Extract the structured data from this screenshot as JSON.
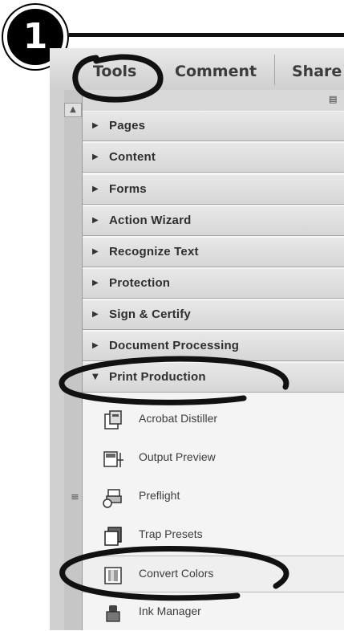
{
  "step": {
    "number": "1"
  },
  "toolbar": {
    "tabs": [
      {
        "label": "Tools"
      },
      {
        "label": "Comment"
      },
      {
        "label": "Share"
      }
    ]
  },
  "panel": {
    "sections": [
      {
        "label": "Pages",
        "state": "collapsed"
      },
      {
        "label": "Content",
        "state": "collapsed"
      },
      {
        "label": "Forms",
        "state": "collapsed"
      },
      {
        "label": "Action Wizard",
        "state": "collapsed"
      },
      {
        "label": "Recognize Text",
        "state": "collapsed"
      },
      {
        "label": "Protection",
        "state": "collapsed"
      },
      {
        "label": "Sign & Certify",
        "state": "collapsed"
      },
      {
        "label": "Document Processing",
        "state": "collapsed"
      },
      {
        "label": "Print Production",
        "state": "expanded"
      }
    ],
    "print_production_items": [
      {
        "label": "Acrobat Distiller",
        "icon": "distiller-icon"
      },
      {
        "label": "Output Preview",
        "icon": "output-preview-icon"
      },
      {
        "label": "Preflight",
        "icon": "preflight-icon"
      },
      {
        "label": "Trap Presets",
        "icon": "trap-presets-icon"
      },
      {
        "label": "Convert Colors",
        "icon": "convert-colors-icon",
        "selected": true
      },
      {
        "label": "Ink Manager",
        "icon": "ink-manager-icon"
      }
    ]
  },
  "annotations": {
    "highlighted": [
      "Tools",
      "Print Production",
      "Convert Colors"
    ],
    "highlight_color": "#111111"
  }
}
